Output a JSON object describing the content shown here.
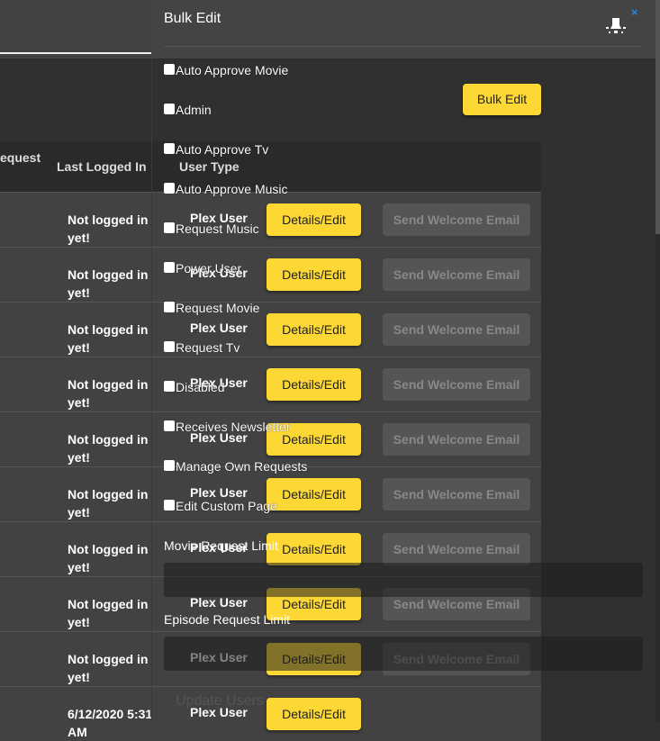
{
  "table": {
    "headers": {
      "request": "equest",
      "last_logged_in": "Last Logged In",
      "user_type": "User Type"
    },
    "rows": [
      {
        "last_logged_in": "Not logged in yet!",
        "user_type": "Plex User",
        "details": "Details/Edit",
        "welcome": "Send Welcome Email"
      },
      {
        "last_logged_in": "Not logged in yet!",
        "user_type": "Plex User",
        "details": "Details/Edit",
        "welcome": "Send Welcome Email"
      },
      {
        "last_logged_in": "Not logged in yet!",
        "user_type": "Plex User",
        "details": "Details/Edit",
        "welcome": "Send Welcome Email"
      },
      {
        "last_logged_in": "Not logged in yet!",
        "user_type": "Plex User",
        "details": "Details/Edit",
        "welcome": "Send Welcome Email"
      },
      {
        "last_logged_in": "Not logged in yet!",
        "user_type": "Plex User",
        "details": "Details/Edit",
        "welcome": "Send Welcome Email"
      },
      {
        "last_logged_in": "Not logged in yet!",
        "user_type": "Plex User",
        "details": "Details/Edit",
        "welcome": "Send Welcome Email"
      },
      {
        "last_logged_in": "Not logged in yet!",
        "user_type": "Plex User",
        "details": "Details/Edit",
        "welcome": "Send Welcome Email"
      },
      {
        "last_logged_in": "Not logged in yet!",
        "user_type": "Plex User",
        "details": "Details/Edit",
        "welcome": "Send Welcome Email"
      },
      {
        "last_logged_in": "Not logged in yet!",
        "user_type": "Plex User",
        "details": "Details/Edit",
        "welcome": "Send Welcome Email"
      },
      {
        "last_logged_in": "6/12/2020 5:31 AM",
        "user_type": "Plex User",
        "details": "Details/Edit"
      }
    ]
  },
  "panel": {
    "title": "Bulk Edit",
    "close": "×",
    "bulk_button": "Bulk Edit",
    "checkboxes": [
      "Auto Approve Movie",
      "Admin",
      "Auto Approve Tv",
      "Auto Approve Music",
      "Request Music",
      "Power User",
      "Request Movie",
      "Request Tv",
      "Disabled",
      "Receives Newsletter",
      "Manage Own Requests",
      "Edit Custom Page"
    ],
    "movie_limit_label": "Movie Request Limit",
    "episode_limit_label": "Episode Request Limit",
    "update_button": "Update Users"
  },
  "colors": {
    "accent": "#fdd835",
    "close": "#1e88e5"
  }
}
